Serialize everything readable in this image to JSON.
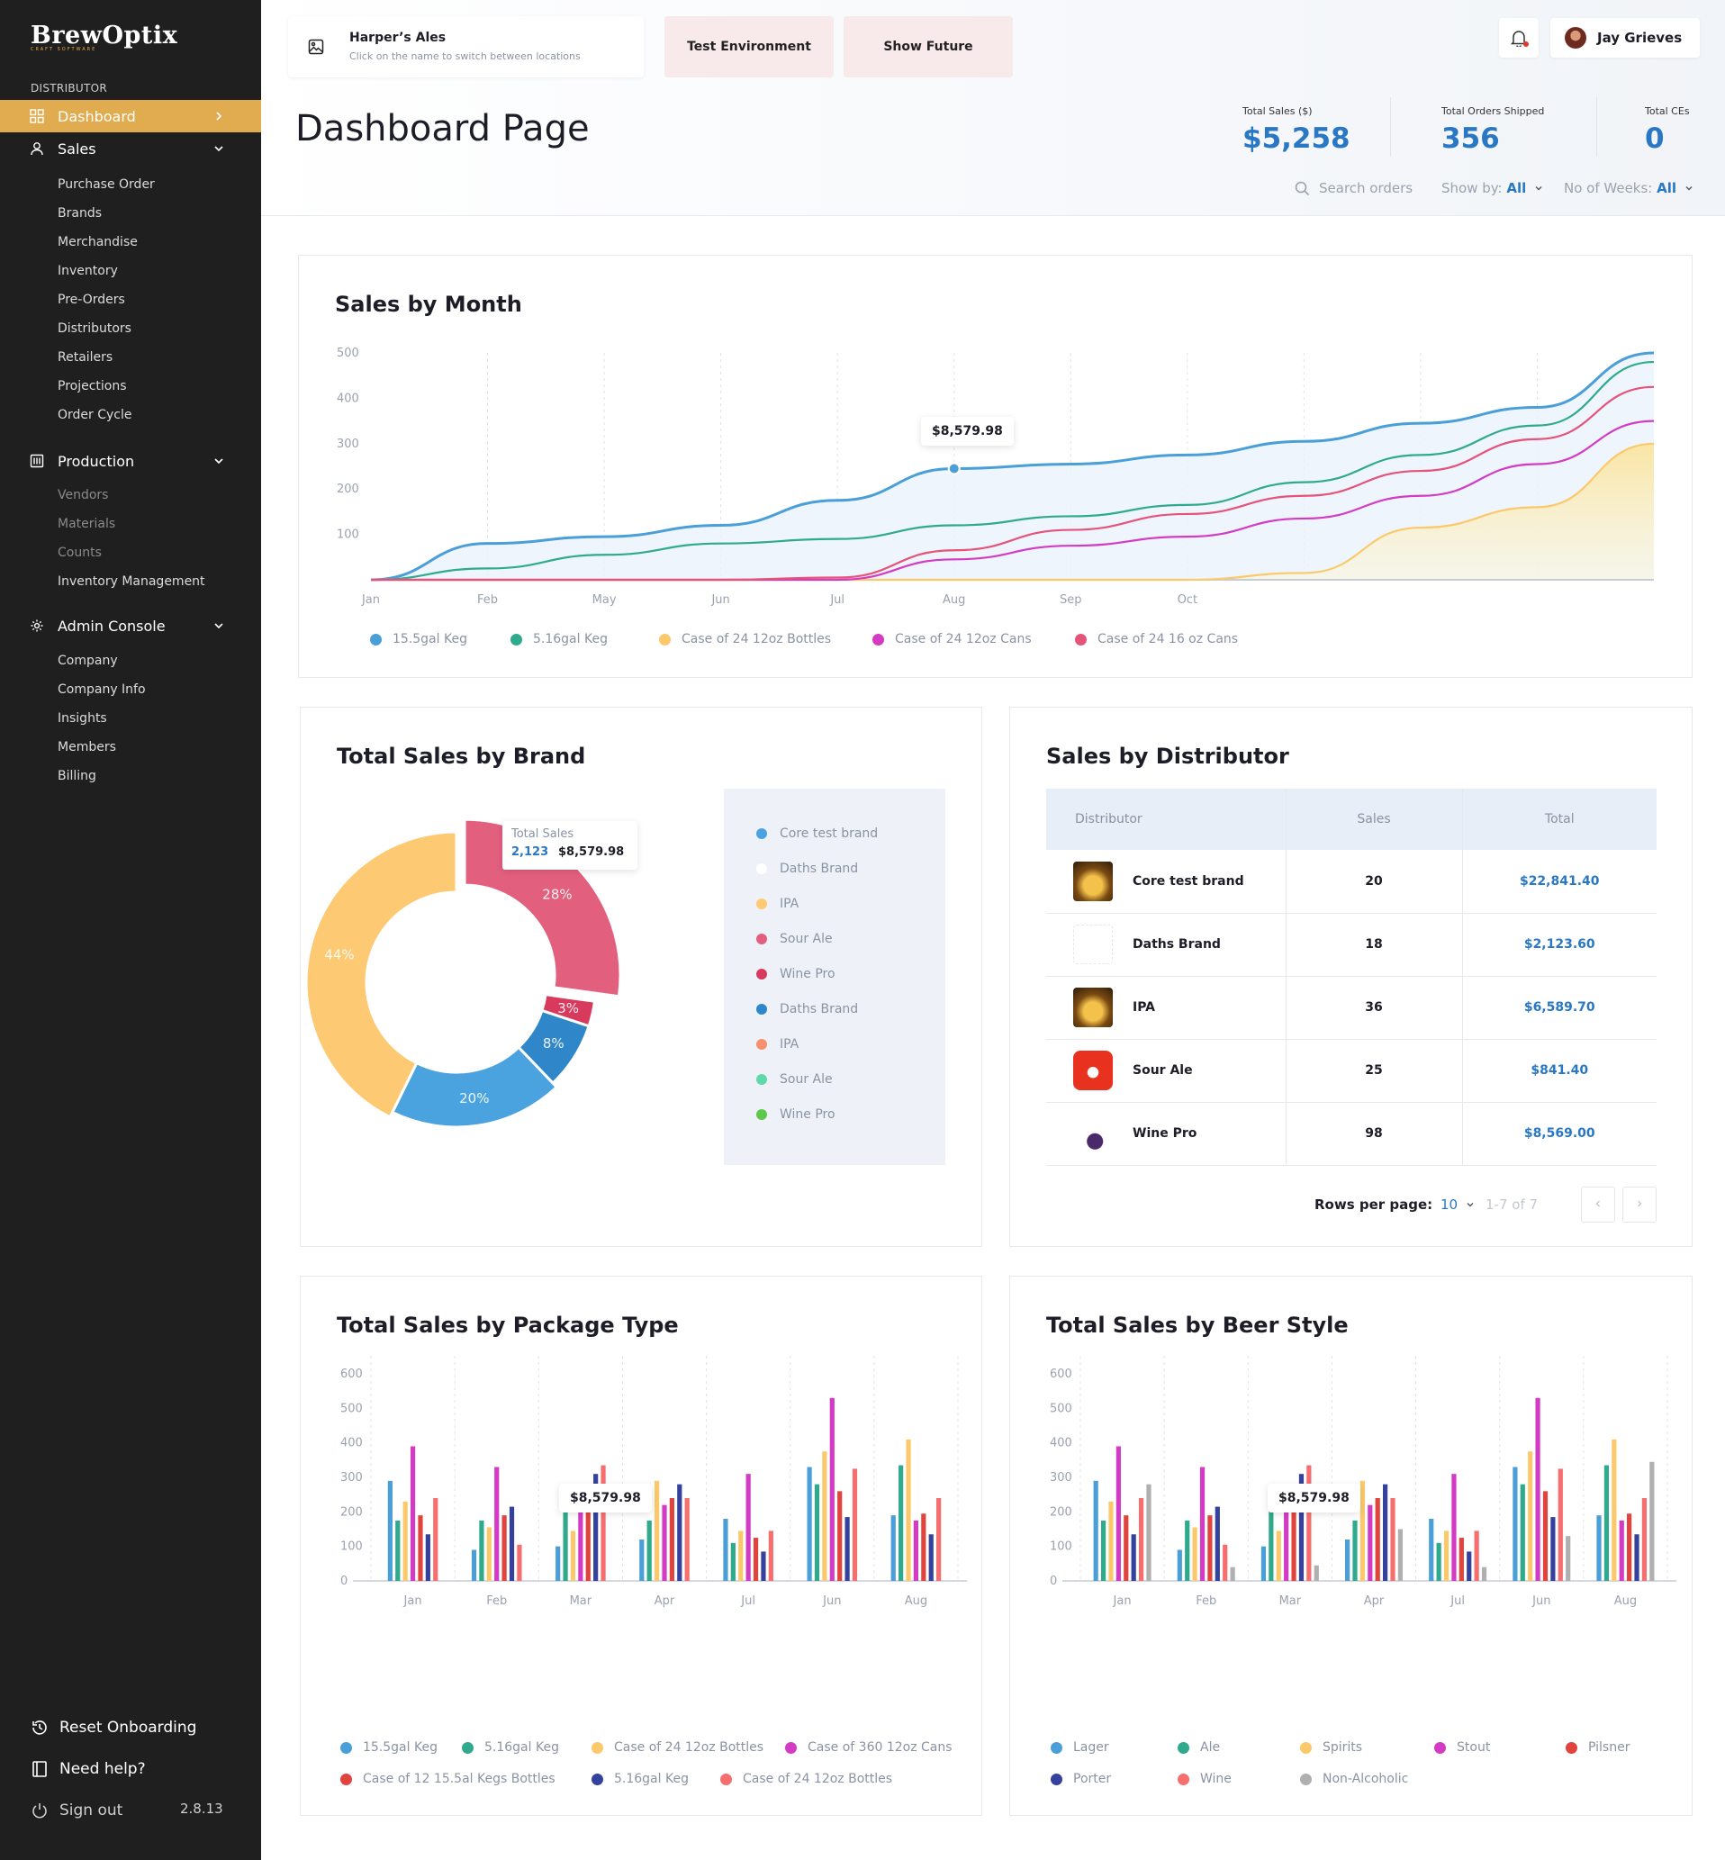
{
  "sidebar": {
    "logo": "BrewOptix",
    "logo_sub": "CRAFT SOFTWARE",
    "section_label": "DISTRIBUTOR",
    "dashboard": "Dashboard",
    "sales": "Sales",
    "sales_items": [
      "Purchase Order",
      "Brands",
      "Merchandise",
      "Inventory",
      "Pre-Orders",
      "Distributors",
      "Retailers",
      "Projections",
      "Order Cycle"
    ],
    "production": "Production",
    "production_items": [
      "Vendors",
      "Materials",
      "Counts",
      "Inventory Management"
    ],
    "admin": "Admin Console",
    "admin_items": [
      "Company",
      "Company Info",
      "Insights",
      "Members",
      "Billing"
    ],
    "reset": "Reset Onboarding",
    "help": "Need help?",
    "signout": "Sign out",
    "version": "2.8.13"
  },
  "header": {
    "location_name": "Harper’s Ales",
    "location_hint": "Click on the name to switch between locations",
    "test_env": "Test Environment",
    "show_future": "Show Future",
    "user_name": "Jay Grieves",
    "page_title": "Dashboard Page",
    "stats": [
      {
        "label": "Total Sales ($)",
        "value": "$5,258"
      },
      {
        "label": "Total Orders Shipped",
        "value": "356"
      },
      {
        "label": "Total CEs",
        "value": "0"
      }
    ],
    "search_placeholder": "Search orders",
    "show_by_label": "Show by:",
    "show_by_value": "All",
    "weeks_label": "No of Weeks:",
    "weeks_value": "All"
  },
  "colors": {
    "accent": "#e1ab4f",
    "primary_blue": "#2a78c4",
    "sidebar_bg": "#1f1f1f"
  },
  "sales_by_month": {
    "title": "Sales by Month",
    "tooltip": "$8,579.98",
    "chart_data": {
      "type": "area",
      "title": "Sales by Month",
      "x": [
        "Jan",
        "Feb",
        "May",
        "Jun",
        "Jul",
        "Aug",
        "Sep",
        "Oct",
        "",
        "",
        "",
        ""
      ],
      "ylim": [
        0,
        500
      ],
      "yticks": [
        100,
        200,
        300,
        400,
        500
      ],
      "series": [
        {
          "name": "15.5gal Keg",
          "color": "#4a9fd8",
          "values": [
            0,
            80,
            95,
            120,
            175,
            245,
            255,
            275,
            305,
            345,
            380,
            500
          ]
        },
        {
          "name": "5.16gal Keg",
          "color": "#2faa8c",
          "values": [
            0,
            25,
            55,
            80,
            90,
            120,
            140,
            165,
            215,
            275,
            340,
            480
          ]
        },
        {
          "name": "Case of 24 12oz Bottles",
          "color": "#fbc96b",
          "values": [
            0,
            0,
            0,
            0,
            0,
            0,
            0,
            0,
            15,
            115,
            160,
            300
          ]
        },
        {
          "name": "Case of 24 12oz Cans",
          "color": "#d33bc4",
          "values": [
            0,
            0,
            0,
            0,
            0,
            45,
            75,
            95,
            135,
            185,
            255,
            350
          ]
        },
        {
          "name": "Case of 24 16 oz Cans",
          "color": "#e55378",
          "values": [
            0,
            0,
            0,
            0,
            5,
            65,
            110,
            145,
            185,
            240,
            310,
            425
          ]
        }
      ]
    }
  },
  "brand_sales": {
    "title": "Total Sales by Brand",
    "tooltip_label": "Total Sales",
    "tooltip_count": "2,123",
    "tooltip_value": "$8,579.98",
    "chart_data": {
      "type": "pie",
      "title": "Total Sales by Brand",
      "slices": [
        {
          "label": "28%",
          "value": 28,
          "color": "#e35f7e"
        },
        {
          "label": "3%",
          "value": 3,
          "color": "#d73a5d"
        },
        {
          "label": "8%",
          "value": 8,
          "color": "#2f87c9"
        },
        {
          "label": "20%",
          "value": 20,
          "color": "#4aa3df"
        },
        {
          "label": "44%",
          "value": 44,
          "color": "#fdca73"
        }
      ]
    },
    "legend": [
      {
        "name": "Core test brand",
        "color": "#4aa3df"
      },
      {
        "name": "Daths Brand",
        "color": "#ffffff"
      },
      {
        "name": "IPA",
        "color": "#fdca73"
      },
      {
        "name": "Sour Ale",
        "color": "#e35f7e"
      },
      {
        "name": "Wine Pro",
        "color": "#d73a5d"
      },
      {
        "name": "Daths Brand",
        "color": "#2f87c9"
      },
      {
        "name": "IPA",
        "color": "#f7916d"
      },
      {
        "name": "Sour Ale",
        "color": "#5fd9a9"
      },
      {
        "name": "Wine Pro",
        "color": "#5cc94a"
      }
    ]
  },
  "distributor": {
    "title": "Sales by Distributor",
    "headers": [
      "Distributor",
      "Sales",
      "Total"
    ],
    "rows": [
      {
        "name": "Core test brand",
        "sales": "20",
        "total": "$22,841.40",
        "thumb": "beer-photo"
      },
      {
        "name": "Daths Brand",
        "sales": "18",
        "total": "$2,123.60",
        "thumb": "placeholder-logo"
      },
      {
        "name": "IPA",
        "sales": "36",
        "total": "$6,589.70",
        "thumb": "beer-photo"
      },
      {
        "name": "Sour Ale",
        "sales": "25",
        "total": "$841.40",
        "thumb": "red-logo"
      },
      {
        "name": "Wine Pro",
        "sales": "98",
        "total": "$8,569.00",
        "thumb": "grape-logo"
      }
    ],
    "rows_per_page_label": "Rows per page:",
    "rows_per_page_value": "10",
    "range": "1-7 of 7"
  },
  "package_type": {
    "title": "Total Sales by  Package Type",
    "tooltip": "$8,579.98",
    "chart_data": {
      "type": "bar",
      "title": "Total Sales by  Package Type",
      "categories": [
        "Jan",
        "Feb",
        "Mar",
        "Apr",
        "Jul",
        "Jun",
        "Aug"
      ],
      "ylim": [
        0,
        600
      ],
      "yticks": [
        0,
        100,
        200,
        300,
        400,
        500,
        600
      ],
      "series": [
        {
          "name": "15.5gal Keg",
          "color": "#4a9fd8",
          "values": [
            290,
            90,
            100,
            120,
            180,
            330,
            190
          ]
        },
        {
          "name": "5.16gal Keg",
          "color": "#2faa8c",
          "values": [
            175,
            175,
            260,
            175,
            110,
            280,
            335
          ]
        },
        {
          "name": "Case of 24 12oz Bottles",
          "color": "#fbc96b",
          "values": [
            230,
            155,
            145,
            290,
            145,
            375,
            410
          ]
        },
        {
          "name": "Case of 360 12oz Cans",
          "color": "#d33bc4",
          "values": [
            390,
            330,
            230,
            220,
            310,
            530,
            175
          ]
        },
        {
          "name": "Case of 12 15.5al Kegs Bottles",
          "color": "#e0443d",
          "values": [
            190,
            190,
            270,
            240,
            125,
            260,
            195
          ]
        },
        {
          "name": "5.16gal Keg",
          "color": "#34429e",
          "values": [
            135,
            215,
            310,
            280,
            85,
            185,
            135
          ]
        },
        {
          "name": "Case of 24 12oz Bottles",
          "color": "#f76e6e",
          "values": [
            240,
            105,
            335,
            240,
            145,
            325,
            240
          ]
        }
      ]
    }
  },
  "beer_style": {
    "title": "Total Sales by Beer Style",
    "tooltip": "$8,579.98",
    "chart_data": {
      "type": "bar",
      "title": "Total Sales by Beer Style",
      "categories": [
        "Jan",
        "Feb",
        "Mar",
        "Apr",
        "Jul",
        "Jun",
        "Aug"
      ],
      "ylim": [
        0,
        600
      ],
      "yticks": [
        0,
        100,
        200,
        300,
        400,
        500,
        600
      ],
      "series": [
        {
          "name": "Lager",
          "color": "#4a9fd8",
          "values": [
            290,
            90,
            100,
            120,
            180,
            330,
            190
          ]
        },
        {
          "name": "Ale",
          "color": "#2faa8c",
          "values": [
            175,
            175,
            260,
            175,
            110,
            280,
            335
          ]
        },
        {
          "name": "Spirits",
          "color": "#fbc96b",
          "values": [
            230,
            155,
            145,
            290,
            145,
            375,
            410
          ]
        },
        {
          "name": "Stout",
          "color": "#d33bc4",
          "values": [
            390,
            330,
            230,
            220,
            310,
            530,
            175
          ]
        },
        {
          "name": "Pilsner",
          "color": "#e0443d",
          "values": [
            190,
            190,
            270,
            240,
            125,
            260,
            195
          ]
        },
        {
          "name": "Porter",
          "color": "#34429e",
          "values": [
            135,
            215,
            310,
            280,
            85,
            185,
            135
          ]
        },
        {
          "name": "Wine",
          "color": "#f76e6e",
          "values": [
            240,
            105,
            335,
            240,
            145,
            325,
            240
          ]
        },
        {
          "name": "Non-Alcoholic",
          "color": "#b0b0b0",
          "values": [
            280,
            40,
            45,
            150,
            40,
            130,
            345
          ]
        }
      ]
    }
  }
}
